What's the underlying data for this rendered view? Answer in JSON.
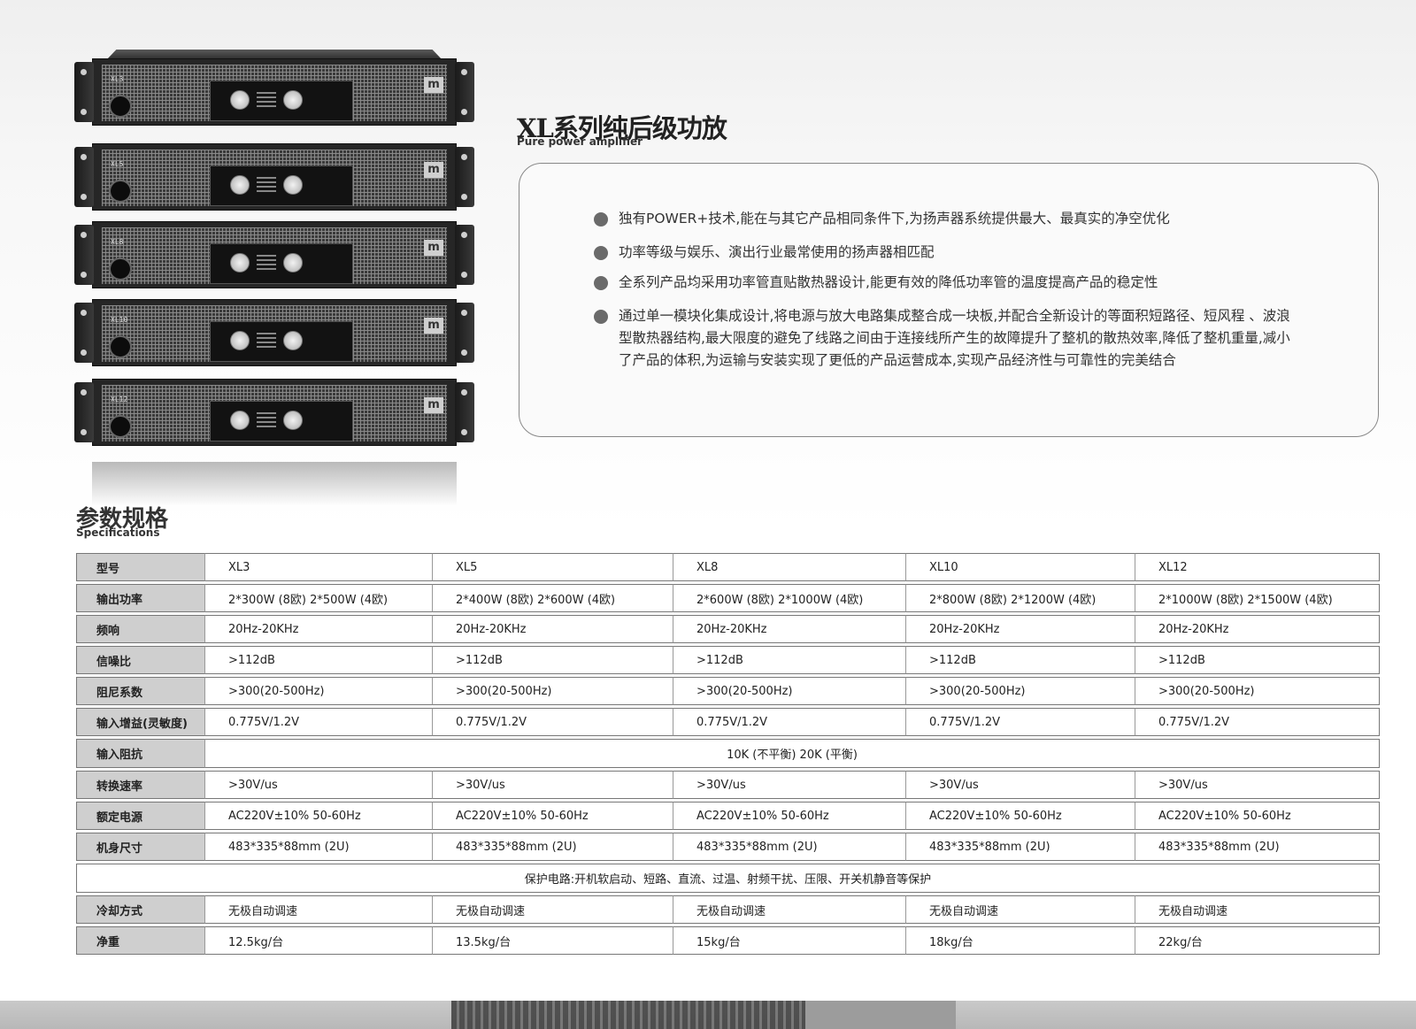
{
  "header": {
    "title": "XL系列纯后级功放",
    "subtitle": "Pure power amplifier"
  },
  "product_units": [
    {
      "model": "XL3"
    },
    {
      "model": "XL5"
    },
    {
      "model": "XL8"
    },
    {
      "model": "XL10"
    },
    {
      "model": "XL12"
    }
  ],
  "features": [
    "独有POWER+技术,能在与其它产品相同条件下,为扬声器系统提供最大、最真实的净空优化",
    "功率等级与娱乐、演出行业最常使用的扬声器相匹配",
    "全系列产品均采用功率管直贴散热器设计,能更有效的降低功率管的温度提高产品的稳定性",
    "通过单一模块化集成设计,将电源与放大电路集成整合成一块板,并配合全新设计的等面积短路径、短风程 、波浪型散热器结构,最大限度的避免了线路之间由于连接线所产生的故障提升了整机的散热效率,降低了整机重量,减小了产品的体积,为运输与安装实现了更低的产品运营成本,实现产品经济性与可靠性的完美结合"
  ],
  "specs": {
    "title": "参数规格",
    "subtitle": "Specifications",
    "rows": [
      {
        "label": "型号",
        "cells": [
          "XL3",
          "XL5",
          "XL8",
          "XL10",
          "XL12"
        ]
      },
      {
        "label": "输出功率",
        "cells": [
          "2*300W (8欧) 2*500W (4欧)",
          "2*400W (8欧) 2*600W (4欧)",
          "2*600W (8欧) 2*1000W (4欧)",
          "2*800W (8欧) 2*1200W (4欧)",
          "2*1000W (8欧) 2*1500W (4欧)"
        ]
      },
      {
        "label": "频响",
        "cells": [
          "20Hz-20KHz",
          "20Hz-20KHz",
          "20Hz-20KHz",
          "20Hz-20KHz",
          "20Hz-20KHz"
        ]
      },
      {
        "label": "信噪比",
        "cells": [
          ">112dB",
          ">112dB",
          ">112dB",
          ">112dB",
          ">112dB"
        ]
      },
      {
        "label": "阻尼系数",
        "cells": [
          ">300(20-500Hz)",
          ">300(20-500Hz)",
          ">300(20-500Hz)",
          ">300(20-500Hz)",
          ">300(20-500Hz)"
        ]
      },
      {
        "label": "输入增益(灵敏度)",
        "cells": [
          "0.775V/1.2V",
          "0.775V/1.2V",
          "0.775V/1.2V",
          "0.775V/1.2V",
          "0.775V/1.2V"
        ]
      },
      {
        "label": "输入阻抗",
        "merged": "10K (不平衡) 20K (平衡)"
      },
      {
        "label": "转换速率",
        "cells": [
          ">30V/us",
          ">30V/us",
          ">30V/us",
          ">30V/us",
          ">30V/us"
        ]
      },
      {
        "label": "额定电源",
        "cells": [
          "AC220V±10% 50-60Hz",
          "AC220V±10% 50-60Hz",
          "AC220V±10% 50-60Hz",
          "AC220V±10% 50-60Hz",
          "AC220V±10% 50-60Hz"
        ]
      },
      {
        "label": "机身尺寸",
        "cells": [
          "483*335*88mm (2U)",
          "483*335*88mm (2U)",
          "483*335*88mm (2U)",
          "483*335*88mm (2U)",
          "483*335*88mm (2U)"
        ]
      },
      {
        "full": "保护电路:开机软启动、短路、直流、过温、射频干扰、压限、开关机静音等保护"
      },
      {
        "label": "冷却方式",
        "cells": [
          "无极自动调速",
          "无极自动调速",
          "无极自动调速",
          "无极自动调速",
          "无极自动调速"
        ]
      },
      {
        "label": "净重",
        "cells": [
          "12.5kg/台",
          "13.5kg/台",
          "15kg/台",
          "18kg/台",
          "22kg/台"
        ]
      }
    ]
  }
}
